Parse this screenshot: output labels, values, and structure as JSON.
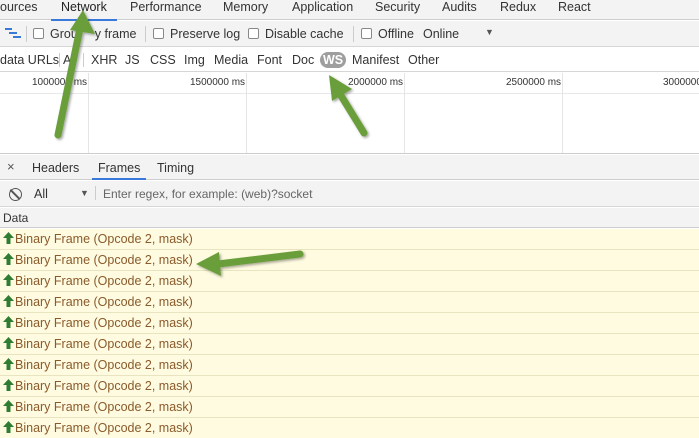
{
  "tabs": [
    "ources",
    "Network",
    "Performance",
    "Memory",
    "Application",
    "Security",
    "Audits",
    "Redux",
    "React"
  ],
  "toolbar": {
    "group_label": "Grou",
    "group_label_2": "y frame",
    "preserve_log": "Preserve log",
    "disable_cache": "Disable cache",
    "offline": "Offline",
    "throttle": "Online"
  },
  "filters": {
    "data_urls": "data URLs",
    "all": "Al",
    "types": [
      "XHR",
      "JS",
      "CSS",
      "Img",
      "Media",
      "Font",
      "Doc"
    ],
    "ws": "WS",
    "manifest": "Manifest",
    "other": "Other"
  },
  "timeline": {
    "ticks": [
      "1000000 ms",
      "1500000 ms",
      "2000000 ms",
      "2500000 ms",
      "3000000"
    ]
  },
  "detail_tabs": {
    "close": "×",
    "headers": "Headers",
    "frames": "Frames",
    "timing": "Timing"
  },
  "frames_filter": {
    "select": "All",
    "placeholder": "Enter regex, for example: (web)?socket"
  },
  "data_table": {
    "header": "Data",
    "rows": [
      "Binary Frame (Opcode 2, mask)",
      "Binary Frame (Opcode 2, mask)",
      "Binary Frame (Opcode 2, mask)",
      "Binary Frame (Opcode 2, mask)",
      "Binary Frame (Opcode 2, mask)",
      "Binary Frame (Opcode 2, mask)",
      "Binary Frame (Opcode 2, mask)",
      "Binary Frame (Opcode 2, mask)",
      "Binary Frame (Opcode 2, mask)",
      "Binary Frame (Opcode 2, mask)"
    ]
  },
  "colors": {
    "accent": "#3879d9",
    "annotation": "#6a9e3a",
    "frame_row": "#fffbe0",
    "sent_arrow": "#2e7d32"
  }
}
